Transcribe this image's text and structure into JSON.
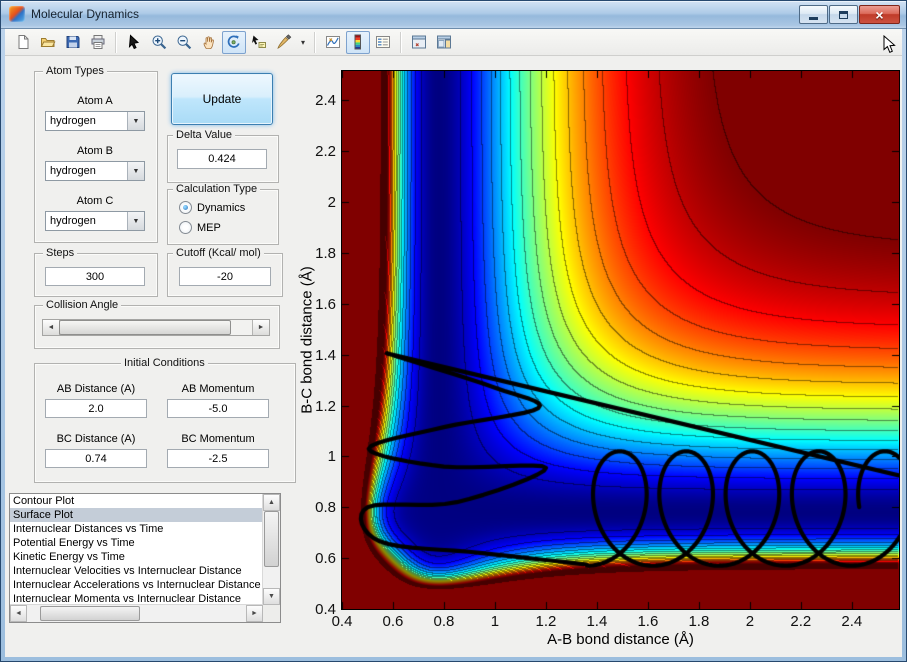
{
  "window": {
    "title": "Molecular Dynamics"
  },
  "titlebar": {
    "minimize": "minimize",
    "maximize": "maximize",
    "close": "close"
  },
  "toolbar": {
    "items": [
      {
        "name": "new-figure",
        "icon": "new-document"
      },
      {
        "name": "open-file",
        "icon": "open-folder"
      },
      {
        "name": "save-figure",
        "icon": "save"
      },
      {
        "name": "print-figure",
        "icon": "print"
      },
      {
        "sep": true
      },
      {
        "name": "edit-plot",
        "icon": "pointer"
      },
      {
        "name": "zoom-in",
        "icon": "zoom-in"
      },
      {
        "name": "zoom-out",
        "icon": "zoom-out"
      },
      {
        "name": "pan",
        "icon": "pan"
      },
      {
        "name": "rotate-3d",
        "icon": "rotate-3d",
        "active": true
      },
      {
        "name": "data-cursor",
        "icon": "data-cursor"
      },
      {
        "name": "brush",
        "icon": "brush",
        "dropdown": true
      },
      {
        "sep": true
      },
      {
        "name": "link-plot",
        "icon": "link-plot"
      },
      {
        "name": "insert-colorbar",
        "icon": "colorbar",
        "active": true
      },
      {
        "name": "insert-legend",
        "icon": "legend"
      },
      {
        "sep": true
      },
      {
        "name": "hide-plot-tools",
        "icon": "hide-plot-tools"
      },
      {
        "name": "show-plot-tools",
        "icon": "show-plot-tools"
      }
    ]
  },
  "panels": {
    "atom_types": {
      "title": "Atom Types",
      "fields": [
        {
          "label": "Atom A",
          "value": "hydrogen"
        },
        {
          "label": "Atom B",
          "value": "hydrogen"
        },
        {
          "label": "Atom C",
          "value": "hydrogen"
        }
      ]
    },
    "update_button_label": "Update",
    "delta": {
      "title": "Delta Value",
      "value": "0.424"
    },
    "calc_type": {
      "title": "Calculation Type",
      "options": [
        {
          "label": "Dynamics",
          "selected": true
        },
        {
          "label": "MEP",
          "selected": false
        }
      ]
    },
    "steps": {
      "title": "Steps",
      "value": "300"
    },
    "cutoff": {
      "title": "Cutoff (Kcal/ mol)",
      "value": "-20"
    },
    "collision_angle": {
      "title": "Collision Angle"
    },
    "initial_conditions": {
      "title": "Initial Conditions",
      "fields": [
        {
          "label": "AB Distance (A)",
          "value": "2.0"
        },
        {
          "label": "AB Momentum",
          "value": "-5.0"
        },
        {
          "label": "BC Distance (A)",
          "value": "0.74"
        },
        {
          "label": "BC Momentum",
          "value": "-2.5"
        }
      ]
    },
    "plot_types": {
      "items": [
        "Contour Plot",
        "Surface Plot",
        "Internuclear Distances vs Time",
        "Potential Energy vs Time",
        "Kinetic Energy vs Time",
        "Internuclear Velocities vs Internuclear Distance",
        "Internuclear Accelerations vs Internuclear Distance",
        "Internuclear Momenta vs Internuclear Distance"
      ],
      "selected_index": 1
    }
  },
  "chart_data": {
    "type": "heatmap",
    "title": "",
    "xlabel": "A-B bond distance (Å)",
    "ylabel": "B-C bond distance (Å)",
    "xlim": [
      0.4,
      2.585
    ],
    "ylim": [
      0.4,
      2.515
    ],
    "xtick_values": [
      0.4,
      0.6,
      0.8,
      1,
      1.2,
      1.4,
      1.6,
      1.8,
      2,
      2.2,
      2.4
    ],
    "xtick_labels": [
      "0.4",
      "0.6",
      "0.8",
      "1",
      "1.2",
      "1.4",
      "1.6",
      "1.8",
      "2",
      "2.2",
      "2.4"
    ],
    "ytick_values": [
      0.4,
      0.6,
      0.8,
      1,
      1.2,
      1.4,
      1.6,
      1.8,
      2,
      2.2,
      2.4
    ],
    "ytick_labels": [
      "0.4",
      "0.6",
      "0.8",
      "1",
      "1.2",
      "1.4",
      "1.6",
      "1.8",
      "2",
      "2.2",
      "2.4"
    ],
    "colormap": "jet",
    "surface": {
      "model": "morse_product_plus_repulsion",
      "re": 0.78,
      "a": 3.2,
      "rep_amp": 8,
      "rep_k": 24,
      "rep_r0": 0.4,
      "vmax": 0.93,
      "contour_levels": 16,
      "contour_vcap": 1.45
    },
    "trajectory": {
      "color": "#000000",
      "width": 4.2,
      "entry_line": [
        [
          2.585,
          0.925
        ],
        [
          0.575,
          1.405
        ]
      ],
      "oscillation_points": [
        [
          0.575,
          1.405
        ],
        [
          1.0,
          1.27
        ],
        [
          1.17,
          1.19
        ],
        [
          0.8,
          1.115
        ],
        [
          0.505,
          1.03
        ],
        [
          0.8,
          0.96
        ],
        [
          1.2,
          0.955
        ],
        [
          0.85,
          0.82
        ],
        [
          0.5,
          0.8
        ],
        [
          0.55,
          0.665
        ],
        [
          0.95,
          0.62
        ],
        [
          1.36,
          0.575
        ]
      ],
      "cycloid": {
        "x0": 1.36,
        "dx_per_loop": 0.26,
        "loops": 4.75,
        "rx": 0.165,
        "ry": 0.225,
        "yc": 0.795,
        "phase": 0
      }
    }
  }
}
